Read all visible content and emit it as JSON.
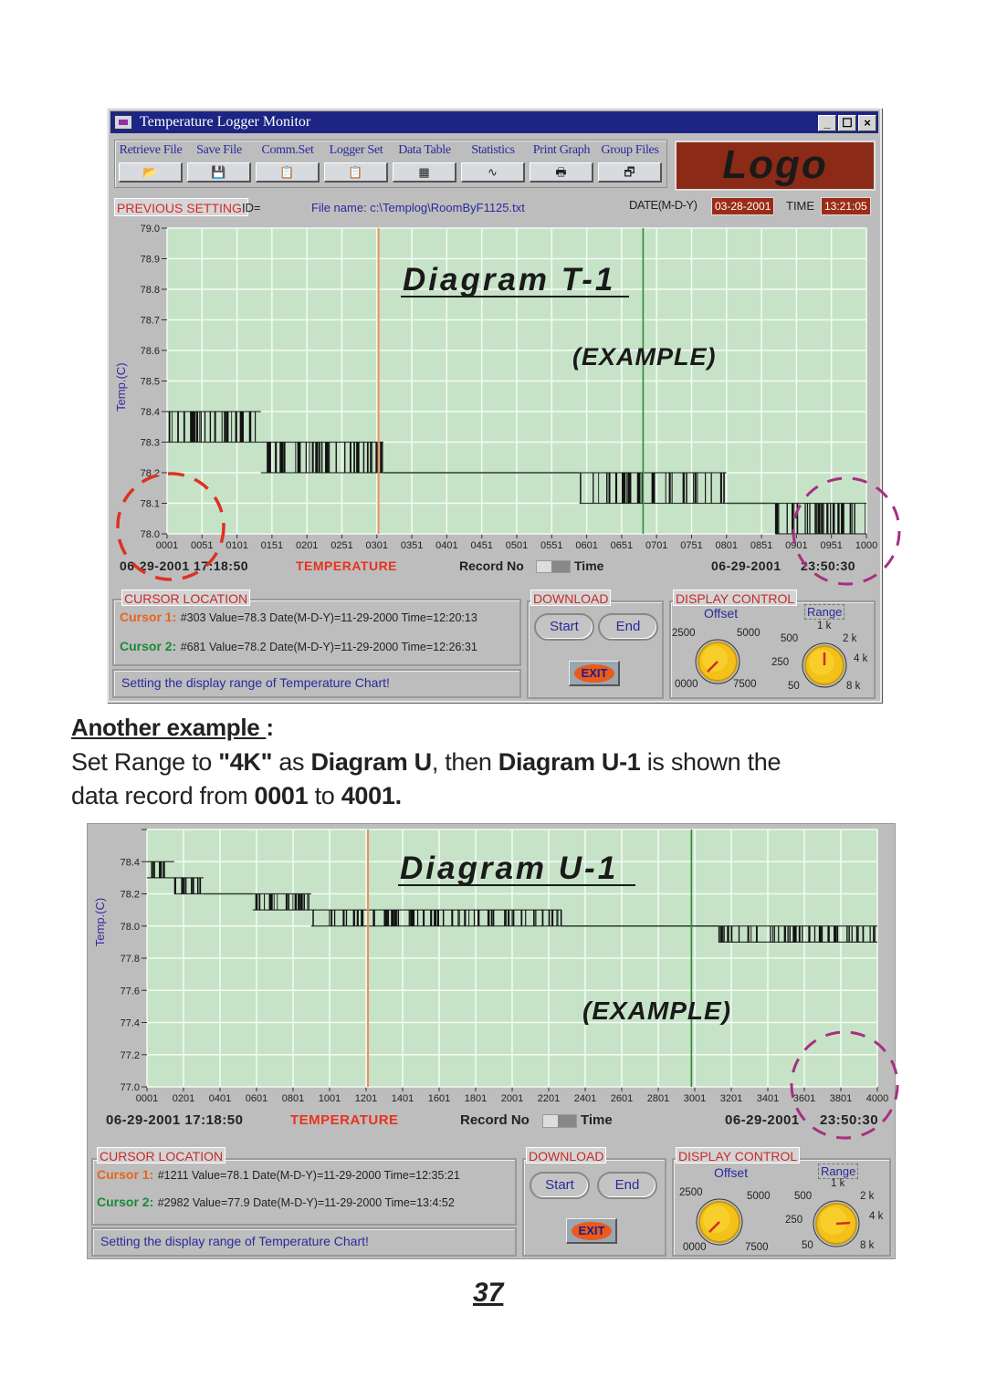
{
  "window": {
    "title": "Temperature Logger Monitor",
    "controls": {
      "minimize": "_",
      "maximize": "☐",
      "close": "×"
    },
    "toolbar": [
      {
        "label": "Retrieve File",
        "icon": "folder-open-icon",
        "glyph": "📂"
      },
      {
        "label": "Save File",
        "icon": "floppy-disk-icon",
        "glyph": "💾"
      },
      {
        "label": "Comm.Set",
        "icon": "clipboard-icon",
        "glyph": "📋"
      },
      {
        "label": "Logger Set",
        "icon": "clipboard-icon",
        "glyph": "📋"
      },
      {
        "label": "Data Table",
        "icon": "table-icon",
        "glyph": "▦"
      },
      {
        "label": "Statistics",
        "icon": "statistics-icon",
        "glyph": "∿"
      },
      {
        "label": "Print Graph",
        "icon": "printer-icon",
        "glyph": "🖶"
      },
      {
        "label": "Group Files",
        "icon": "group-files-icon",
        "glyph": "🗗"
      }
    ],
    "logo": "Logo",
    "previous_setting": "PREVIOUS SETTING:",
    "id_label": "ID=",
    "file_name": "File name: c:\\Templog\\RoomByF1125.txt",
    "date_label": "DATE(M-D-Y)",
    "date_value": "03-28-2001",
    "time_label": "TIME",
    "time_value": "13:21:05"
  },
  "diagrams": [
    {
      "overlay_title": "Diagram T-1",
      "overlay_example": "(EXAMPLE)",
      "start_datetime": "06-29-2001 17:18:50",
      "series_label": "TEMPERATURE",
      "toggle_left": "Record No",
      "toggle_right": "Time",
      "end_date": "06-29-2001",
      "end_time": "23:50:30",
      "cursor_location_title": "CURSOR LOCATION",
      "cursor1_label": "Cursor 1:",
      "cursor1_text": "#303  Value=78.3 Date(M-D-Y)=11-29-2000 Time=12:20:13",
      "cursor2_label": "Cursor 2:",
      "cursor2_text": "#681  Value=78.2 Date(M-D-Y)=11-29-2000 Time=12:26:31",
      "status": "Setting the display range of Temperature Chart!",
      "download_title": "DOWNLOAD",
      "start_btn": "Start",
      "end_btn": "End",
      "exit_btn": "EXIT",
      "display_control_title": "DISPLAY CONTROL",
      "offset_label": "Offset",
      "offset_ticks": [
        "2500",
        "5000",
        "0000",
        "7500"
      ],
      "offset_value": "0000",
      "range_label": "Range",
      "range_ticks": [
        "1 k",
        "500",
        "2 k",
        "250",
        "4 k",
        "50",
        "8 k"
      ],
      "range_value": "1 k"
    },
    {
      "overlay_title": "Diagram U-1",
      "overlay_example": "(EXAMPLE)",
      "start_datetime": "06-29-2001 17:18:50",
      "series_label": "TEMPERATURE",
      "toggle_left": "Record No",
      "toggle_right": "Time",
      "end_date": "06-29-2001",
      "end_time": "23:50:30",
      "cursor_location_title": "CURSOR LOCATION",
      "cursor1_label": "Cursor 1:",
      "cursor1_text": "#1211  Value=78.1 Date(M-D-Y)=11-29-2000 Time=12:35:21",
      "cursor2_label": "Cursor 2:",
      "cursor2_text": "#2982  Value=77.9 Date(M-D-Y)=11-29-2000 Time=13:4:52",
      "status": "Setting the display range of Temperature Chart!",
      "download_title": "DOWNLOAD",
      "start_btn": "Start",
      "end_btn": "End",
      "exit_btn": "EXIT",
      "display_control_title": "DISPLAY CONTROL",
      "offset_label": "Offset",
      "offset_ticks": [
        "2500",
        "5000",
        "0000",
        "7500"
      ],
      "offset_value": "0000",
      "range_label": "Range",
      "range_ticks": [
        "1 k",
        "500",
        "2 k",
        "250",
        "4 k",
        "50",
        "8 k"
      ],
      "range_value": "4 k"
    }
  ],
  "text": {
    "another_example": "Another example ",
    "colon": ":",
    "line1": [
      {
        "t": "Set Range to ",
        "b": false
      },
      {
        "t": "\"4K\"",
        "b": true
      },
      {
        "t": " as ",
        "b": false
      },
      {
        "t": "Diagram U",
        "b": true
      },
      {
        "t": ", then ",
        "b": false
      },
      {
        "t": "Diagram U-1",
        "b": true
      },
      {
        "t": "  is shown the",
        "b": false
      }
    ],
    "line2": [
      {
        "t": "data record from ",
        "b": false
      },
      {
        "t": "0001",
        "b": true
      },
      {
        "t": " to ",
        "b": false
      },
      {
        "t": "4001.",
        "b": true
      }
    ],
    "page_number": "37"
  },
  "chart_data": [
    {
      "type": "line",
      "title": "Diagram T-1",
      "xlabel": "Record No",
      "ylabel": "Temp.(C)",
      "ylim": [
        78.0,
        79.0
      ],
      "xlim": [
        1,
        1000
      ],
      "yticks": [
        "78.0",
        "78.1",
        "78.2",
        "78.3",
        "78.4",
        "78.5",
        "78.6",
        "78.7",
        "78.8",
        "78.9",
        "79.0"
      ],
      "xticks": [
        "0001",
        "0051",
        "0101",
        "0151",
        "0201",
        "0251",
        "0301",
        "0351",
        "0401",
        "0451",
        "0501",
        "0551",
        "0601",
        "0651",
        "0701",
        "0751",
        "0801",
        "0851",
        "0901",
        "0951",
        "1000"
      ],
      "grid": true,
      "cursor1_x": 303,
      "cursor2_x": 681,
      "segments": [
        {
          "x0": 1,
          "x1": 135,
          "lo": 78.3,
          "hi": 78.4
        },
        {
          "x0": 135,
          "x1": 300,
          "lo": 78.2,
          "hi": 78.3
        },
        {
          "x0": 300,
          "x1": 310,
          "lo": 78.2,
          "hi": 78.3
        },
        {
          "x0": 310,
          "x1": 590,
          "lo": 78.2,
          "hi": 78.2
        },
        {
          "x0": 590,
          "x1": 800,
          "lo": 78.1,
          "hi": 78.2
        },
        {
          "x0": 800,
          "x1": 870,
          "lo": 78.1,
          "hi": 78.1
        },
        {
          "x0": 870,
          "x1": 1000,
          "lo": 78.0,
          "hi": 78.1
        }
      ]
    },
    {
      "type": "line",
      "title": "Diagram U-1",
      "xlabel": "Record No",
      "ylabel": "Temp.(C)",
      "ylim": [
        77.0,
        78.6
      ],
      "xlim": [
        1,
        4000
      ],
      "yticks": [
        "77.0",
        "77.2",
        "77.4",
        "77.6",
        "77.8",
        "78.0",
        "78.2",
        "78.4",
        ""
      ],
      "xticks": [
        "0001",
        "0201",
        "0401",
        "0601",
        "0801",
        "1001",
        "1201",
        "1401",
        "1601",
        "1801",
        "2001",
        "2201",
        "2401",
        "2601",
        "2801",
        "3001",
        "3201",
        "3401",
        "3601",
        "3801",
        "4000"
      ],
      "grid": true,
      "cursor1_x": 1211,
      "cursor2_x": 2982,
      "segments": [
        {
          "x0": 1,
          "x1": 150,
          "lo": 78.3,
          "hi": 78.4
        },
        {
          "x0": 150,
          "x1": 310,
          "lo": 78.2,
          "hi": 78.3
        },
        {
          "x0": 310,
          "x1": 580,
          "lo": 78.2,
          "hi": 78.2
        },
        {
          "x0": 580,
          "x1": 900,
          "lo": 78.1,
          "hi": 78.2
        },
        {
          "x0": 900,
          "x1": 2270,
          "lo": 78.0,
          "hi": 78.1
        },
        {
          "x0": 2270,
          "x1": 3130,
          "lo": 78.0,
          "hi": 78.0
        },
        {
          "x0": 3130,
          "x1": 4000,
          "lo": 77.9,
          "hi": 78.0
        }
      ]
    }
  ]
}
